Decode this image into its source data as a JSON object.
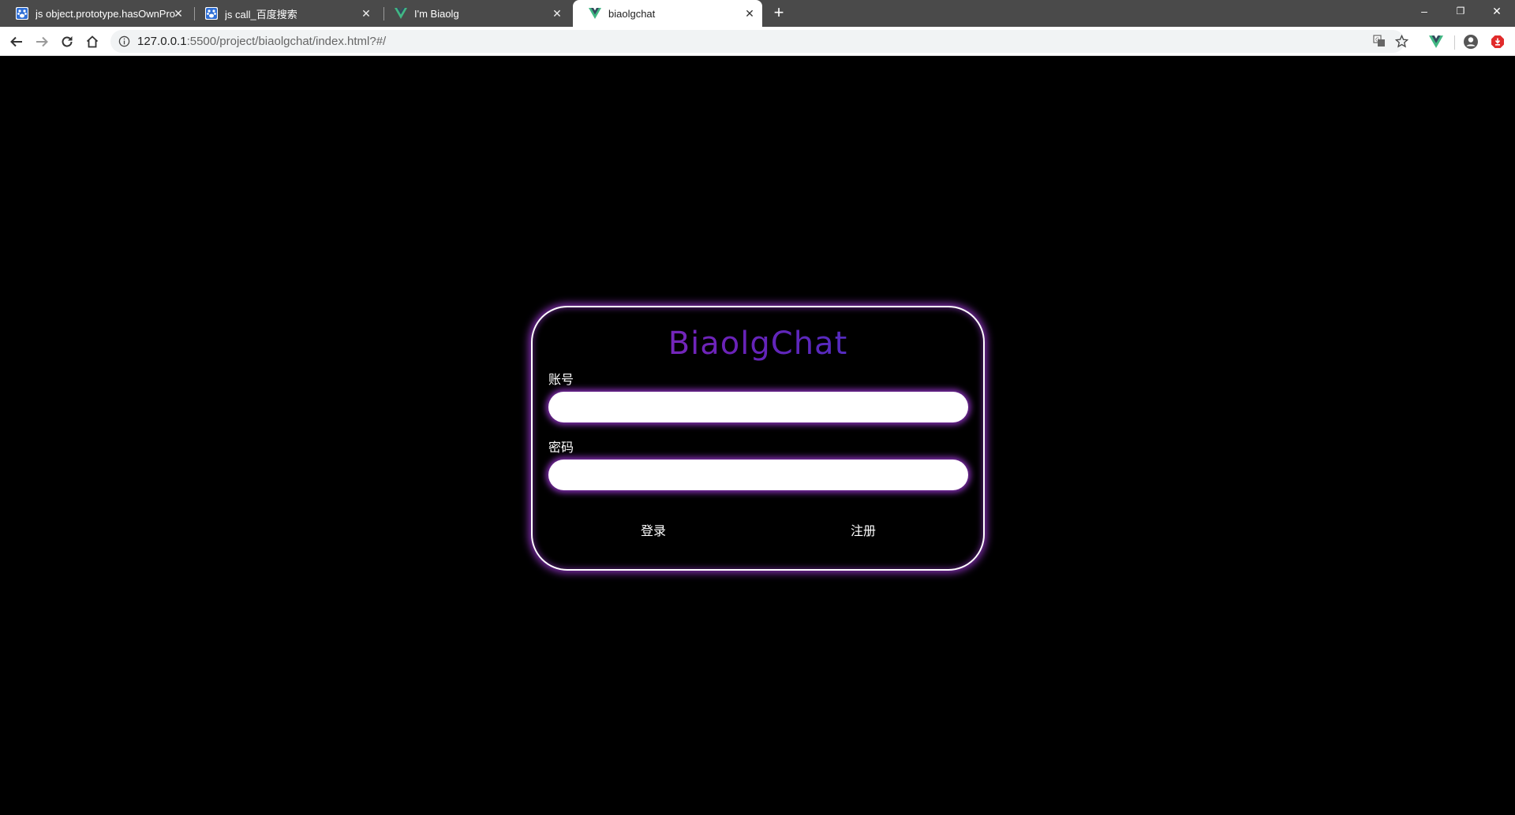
{
  "browser": {
    "tabs": [
      {
        "title": "js object.prototype.hasOwnPro",
        "favicon": "baidu-paw-icon",
        "active": false
      },
      {
        "title": "js call_百度搜索",
        "favicon": "baidu-paw-icon",
        "active": false
      },
      {
        "title": "I'm Biaolg",
        "favicon": "vue-logo-icon",
        "active": false
      },
      {
        "title": "biaolgchat",
        "favicon": "vue-logo-icon",
        "active": true
      }
    ],
    "new_tab_label": "+",
    "url_host": "127.0.0.1",
    "url_rest": ":5500/project/biaolgchat/index.html?#/",
    "window_controls": {
      "minimize": "–",
      "restore": "❐",
      "close": "✕"
    }
  },
  "login": {
    "brand": "BiaolgChat",
    "account_label": "账号",
    "account_value": "",
    "password_label": "密码",
    "password_value": "",
    "login_button": "登录",
    "register_button": "注册"
  },
  "colors": {
    "background": "#000000",
    "card_border": "#ffffff",
    "glow": "#aa3ce6",
    "brand_gradient_start": "#8a2fc0",
    "brand_gradient_end": "#3a36c8"
  }
}
